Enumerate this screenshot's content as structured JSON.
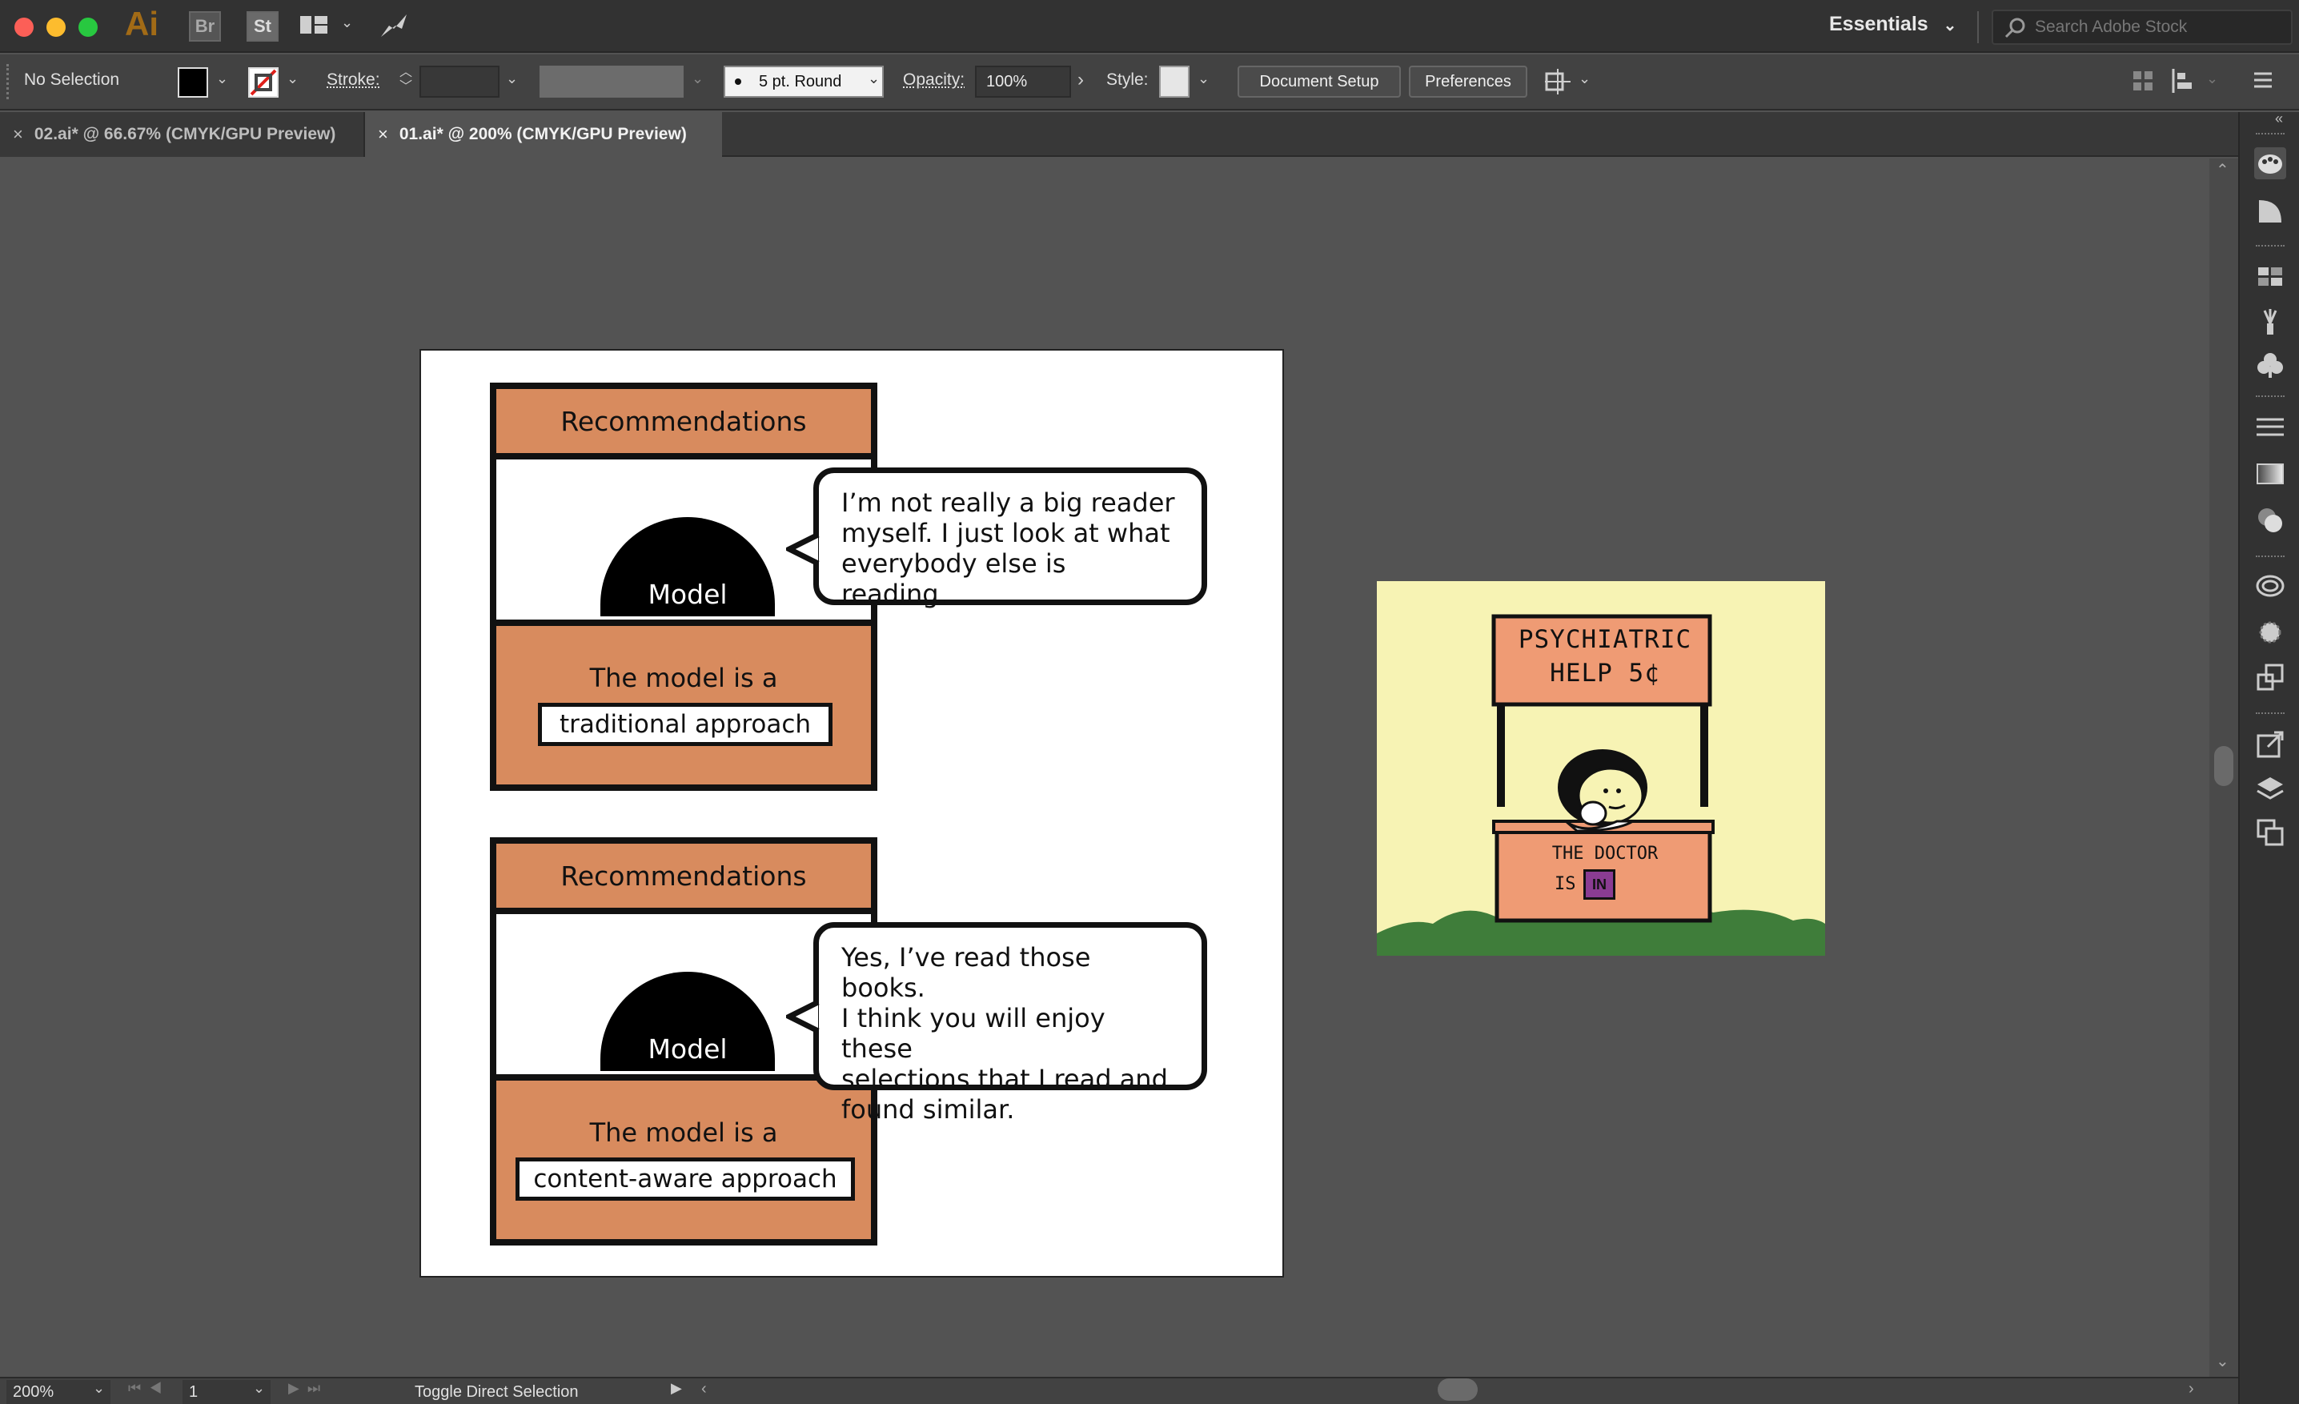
{
  "app": {
    "logo": "Ai",
    "bridge_icon": "Br",
    "stock_icon": "St",
    "workspace": "Essentials",
    "search_placeholder": "Search Adobe Stock"
  },
  "control_bar": {
    "selection": "No Selection",
    "stroke_label": "Stroke:",
    "brush": "5 pt. Round",
    "opacity_label": "Opacity:",
    "opacity_value": "100%",
    "style_label": "Style:",
    "document_setup": "Document Setup",
    "preferences": "Preferences"
  },
  "tabs": [
    {
      "label": "02.ai* @ 66.67% (CMYK/GPU Preview)",
      "active": false
    },
    {
      "label": "01.ai* @ 200% (CMYK/GPU Preview)",
      "active": true
    }
  ],
  "artboard": {
    "panels": [
      {
        "header": "Recommendations",
        "model_label": "Model",
        "caption": "The model is a",
        "approach": "traditional approach",
        "bubble_lines": [
          "I’m not really a big reader",
          "myself. I just look at what",
          "everybody else is reading."
        ]
      },
      {
        "header": "Recommendations",
        "model_label": "Model",
        "caption": "The model is a",
        "approach": "content-aware approach",
        "bubble_lines": [
          "Yes, I’ve read those books.",
          "I think you will enjoy these",
          "selections that I read and",
          "found similar."
        ]
      }
    ]
  },
  "comic": {
    "sign_line1": "PSYCHIATRIC",
    "sign_line2": "HELP 5¢",
    "booth_line1": "THE DOCTOR",
    "booth_is": "IS",
    "booth_in": "IN"
  },
  "status_bar": {
    "zoom": "200%",
    "artboard_number": "1",
    "tool_hint": "Toggle Direct Selection"
  },
  "colors": {
    "panel_fill": "#d88b5e",
    "comic_bg": "#f7f3b4",
    "grass": "#3f7d3a",
    "sign_fill": "#ef9b74",
    "in_badge": "#8a3c92"
  }
}
